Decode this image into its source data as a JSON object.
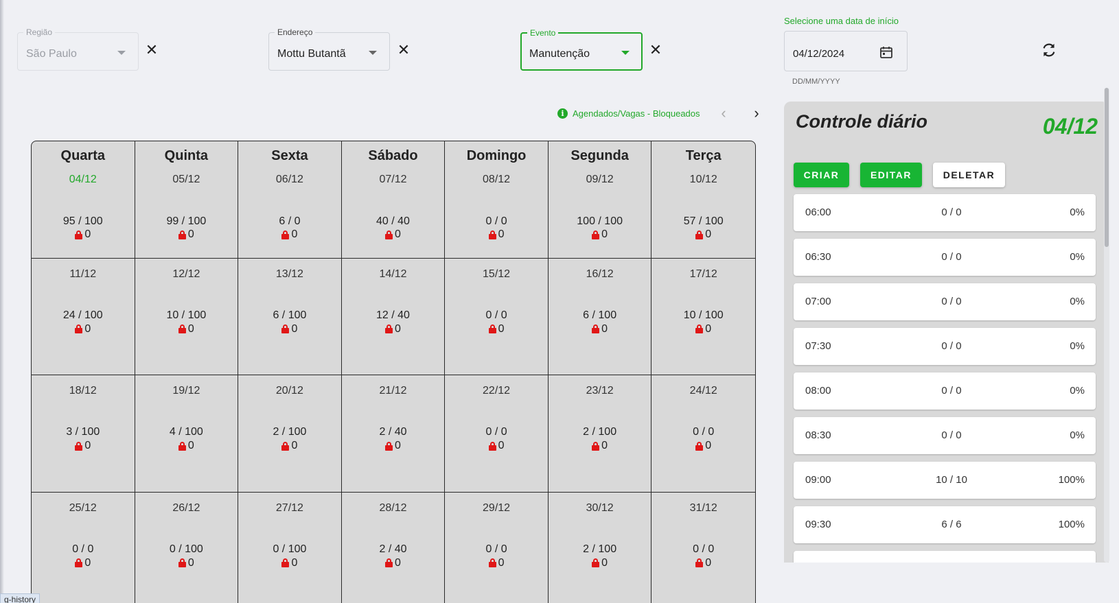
{
  "filters": {
    "region": {
      "label": "Região",
      "value": "São Paulo"
    },
    "address": {
      "label": "Endereço",
      "value": "Mottu Butantã"
    },
    "event": {
      "label": "Evento",
      "value": "Manutenção"
    },
    "date": {
      "hint_top": "Selecione uma data de início",
      "value": "04/12/2024",
      "hint_bottom": "DD/MM/YYYY"
    }
  },
  "legend": {
    "text": "Agendados/Vagas - Bloqueados"
  },
  "calendar": {
    "weekdays": [
      "Quarta",
      "Quinta",
      "Sexta",
      "Sábado",
      "Domingo",
      "Segunda",
      "Terça"
    ],
    "days": [
      {
        "date": "04/12",
        "count": "95 / 100",
        "blocked": "0"
      },
      {
        "date": "05/12",
        "count": "99 / 100",
        "blocked": "0"
      },
      {
        "date": "06/12",
        "count": "6 / 0",
        "blocked": "0"
      },
      {
        "date": "07/12",
        "count": "40 / 40",
        "blocked": "0"
      },
      {
        "date": "08/12",
        "count": "0 / 0",
        "blocked": "0"
      },
      {
        "date": "09/12",
        "count": "100 / 100",
        "blocked": "0"
      },
      {
        "date": "10/12",
        "count": "57 / 100",
        "blocked": "0"
      },
      {
        "date": "11/12",
        "count": "24 / 100",
        "blocked": "0"
      },
      {
        "date": "12/12",
        "count": "10 / 100",
        "blocked": "0"
      },
      {
        "date": "13/12",
        "count": "6 / 100",
        "blocked": "0"
      },
      {
        "date": "14/12",
        "count": "12 / 40",
        "blocked": "0"
      },
      {
        "date": "15/12",
        "count": "0 / 0",
        "blocked": "0"
      },
      {
        "date": "16/12",
        "count": "6 / 100",
        "blocked": "0"
      },
      {
        "date": "17/12",
        "count": "10 / 100",
        "blocked": "0"
      },
      {
        "date": "18/12",
        "count": "3 / 100",
        "blocked": "0"
      },
      {
        "date": "19/12",
        "count": "4 / 100",
        "blocked": "0"
      },
      {
        "date": "20/12",
        "count": "2 / 100",
        "blocked": "0"
      },
      {
        "date": "21/12",
        "count": "2 / 40",
        "blocked": "0"
      },
      {
        "date": "22/12",
        "count": "0 / 0",
        "blocked": "0"
      },
      {
        "date": "23/12",
        "count": "2 / 100",
        "blocked": "0"
      },
      {
        "date": "24/12",
        "count": "0 / 0",
        "blocked": "0"
      },
      {
        "date": "25/12",
        "count": "0 / 0",
        "blocked": "0"
      },
      {
        "date": "26/12",
        "count": "0 / 100",
        "blocked": "0"
      },
      {
        "date": "27/12",
        "count": "0 / 100",
        "blocked": "0"
      },
      {
        "date": "28/12",
        "count": "2 / 40",
        "blocked": "0"
      },
      {
        "date": "29/12",
        "count": "0 / 0",
        "blocked": "0"
      },
      {
        "date": "30/12",
        "count": "2 / 100",
        "blocked": "0"
      },
      {
        "date": "31/12",
        "count": "0 / 0",
        "blocked": "0"
      }
    ]
  },
  "panel": {
    "title": "Controle diário",
    "date": "04/12",
    "buttons": {
      "create": "CRIAR",
      "edit": "EDITAR",
      "delete": "DELETAR"
    },
    "slots": [
      {
        "time": "06:00",
        "count": "0 / 0",
        "percent": "0%"
      },
      {
        "time": "06:30",
        "count": "0 / 0",
        "percent": "0%"
      },
      {
        "time": "07:00",
        "count": "0 / 0",
        "percent": "0%"
      },
      {
        "time": "07:30",
        "count": "0 / 0",
        "percent": "0%"
      },
      {
        "time": "08:00",
        "count": "0 / 0",
        "percent": "0%"
      },
      {
        "time": "08:30",
        "count": "0 / 0",
        "percent": "0%"
      },
      {
        "time": "09:00",
        "count": "10 / 10",
        "percent": "100%"
      },
      {
        "time": "09:30",
        "count": "6 / 6",
        "percent": "100%"
      },
      {
        "time": "",
        "count": "",
        "percent": ""
      }
    ]
  },
  "status_tip": "g-history",
  "colors": {
    "accent": "#22a82a",
    "button_green": "#18b534",
    "lock": "#e01717",
    "cell_bg": "#d9d9d9"
  }
}
